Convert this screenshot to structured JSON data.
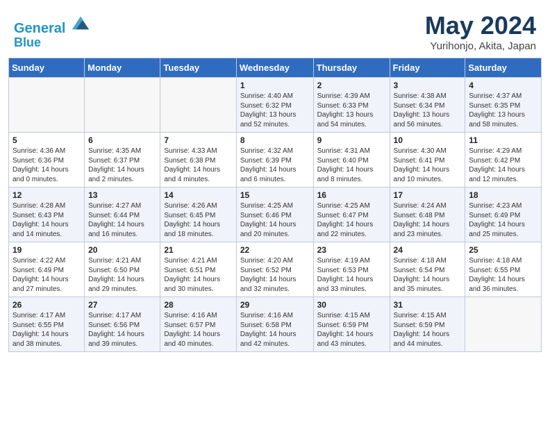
{
  "header": {
    "logo_line1": "General",
    "logo_line2": "Blue",
    "title": "May 2024",
    "subtitle": "Yurihonjo, Akita, Japan"
  },
  "days_of_week": [
    "Sunday",
    "Monday",
    "Tuesday",
    "Wednesday",
    "Thursday",
    "Friday",
    "Saturday"
  ],
  "weeks": [
    [
      {
        "day": "",
        "info": ""
      },
      {
        "day": "",
        "info": ""
      },
      {
        "day": "",
        "info": ""
      },
      {
        "day": "1",
        "info": "Sunrise: 4:40 AM\nSunset: 6:32 PM\nDaylight: 13 hours and 52 minutes."
      },
      {
        "day": "2",
        "info": "Sunrise: 4:39 AM\nSunset: 6:33 PM\nDaylight: 13 hours and 54 minutes."
      },
      {
        "day": "3",
        "info": "Sunrise: 4:38 AM\nSunset: 6:34 PM\nDaylight: 13 hours and 56 minutes."
      },
      {
        "day": "4",
        "info": "Sunrise: 4:37 AM\nSunset: 6:35 PM\nDaylight: 13 hours and 58 minutes."
      }
    ],
    [
      {
        "day": "5",
        "info": "Sunrise: 4:36 AM\nSunset: 6:36 PM\nDaylight: 14 hours and 0 minutes."
      },
      {
        "day": "6",
        "info": "Sunrise: 4:35 AM\nSunset: 6:37 PM\nDaylight: 14 hours and 2 minutes."
      },
      {
        "day": "7",
        "info": "Sunrise: 4:33 AM\nSunset: 6:38 PM\nDaylight: 14 hours and 4 minutes."
      },
      {
        "day": "8",
        "info": "Sunrise: 4:32 AM\nSunset: 6:39 PM\nDaylight: 14 hours and 6 minutes."
      },
      {
        "day": "9",
        "info": "Sunrise: 4:31 AM\nSunset: 6:40 PM\nDaylight: 14 hours and 8 minutes."
      },
      {
        "day": "10",
        "info": "Sunrise: 4:30 AM\nSunset: 6:41 PM\nDaylight: 14 hours and 10 minutes."
      },
      {
        "day": "11",
        "info": "Sunrise: 4:29 AM\nSunset: 6:42 PM\nDaylight: 14 hours and 12 minutes."
      }
    ],
    [
      {
        "day": "12",
        "info": "Sunrise: 4:28 AM\nSunset: 6:43 PM\nDaylight: 14 hours and 14 minutes."
      },
      {
        "day": "13",
        "info": "Sunrise: 4:27 AM\nSunset: 6:44 PM\nDaylight: 14 hours and 16 minutes."
      },
      {
        "day": "14",
        "info": "Sunrise: 4:26 AM\nSunset: 6:45 PM\nDaylight: 14 hours and 18 minutes."
      },
      {
        "day": "15",
        "info": "Sunrise: 4:25 AM\nSunset: 6:46 PM\nDaylight: 14 hours and 20 minutes."
      },
      {
        "day": "16",
        "info": "Sunrise: 4:25 AM\nSunset: 6:47 PM\nDaylight: 14 hours and 22 minutes."
      },
      {
        "day": "17",
        "info": "Sunrise: 4:24 AM\nSunset: 6:48 PM\nDaylight: 14 hours and 23 minutes."
      },
      {
        "day": "18",
        "info": "Sunrise: 4:23 AM\nSunset: 6:49 PM\nDaylight: 14 hours and 25 minutes."
      }
    ],
    [
      {
        "day": "19",
        "info": "Sunrise: 4:22 AM\nSunset: 6:49 PM\nDaylight: 14 hours and 27 minutes."
      },
      {
        "day": "20",
        "info": "Sunrise: 4:21 AM\nSunset: 6:50 PM\nDaylight: 14 hours and 29 minutes."
      },
      {
        "day": "21",
        "info": "Sunrise: 4:21 AM\nSunset: 6:51 PM\nDaylight: 14 hours and 30 minutes."
      },
      {
        "day": "22",
        "info": "Sunrise: 4:20 AM\nSunset: 6:52 PM\nDaylight: 14 hours and 32 minutes."
      },
      {
        "day": "23",
        "info": "Sunrise: 4:19 AM\nSunset: 6:53 PM\nDaylight: 14 hours and 33 minutes."
      },
      {
        "day": "24",
        "info": "Sunrise: 4:18 AM\nSunset: 6:54 PM\nDaylight: 14 hours and 35 minutes."
      },
      {
        "day": "25",
        "info": "Sunrise: 4:18 AM\nSunset: 6:55 PM\nDaylight: 14 hours and 36 minutes."
      }
    ],
    [
      {
        "day": "26",
        "info": "Sunrise: 4:17 AM\nSunset: 6:55 PM\nDaylight: 14 hours and 38 minutes."
      },
      {
        "day": "27",
        "info": "Sunrise: 4:17 AM\nSunset: 6:56 PM\nDaylight: 14 hours and 39 minutes."
      },
      {
        "day": "28",
        "info": "Sunrise: 4:16 AM\nSunset: 6:57 PM\nDaylight: 14 hours and 40 minutes."
      },
      {
        "day": "29",
        "info": "Sunrise: 4:16 AM\nSunset: 6:58 PM\nDaylight: 14 hours and 42 minutes."
      },
      {
        "day": "30",
        "info": "Sunrise: 4:15 AM\nSunset: 6:59 PM\nDaylight: 14 hours and 43 minutes."
      },
      {
        "day": "31",
        "info": "Sunrise: 4:15 AM\nSunset: 6:59 PM\nDaylight: 14 hours and 44 minutes."
      },
      {
        "day": "",
        "info": ""
      }
    ]
  ]
}
